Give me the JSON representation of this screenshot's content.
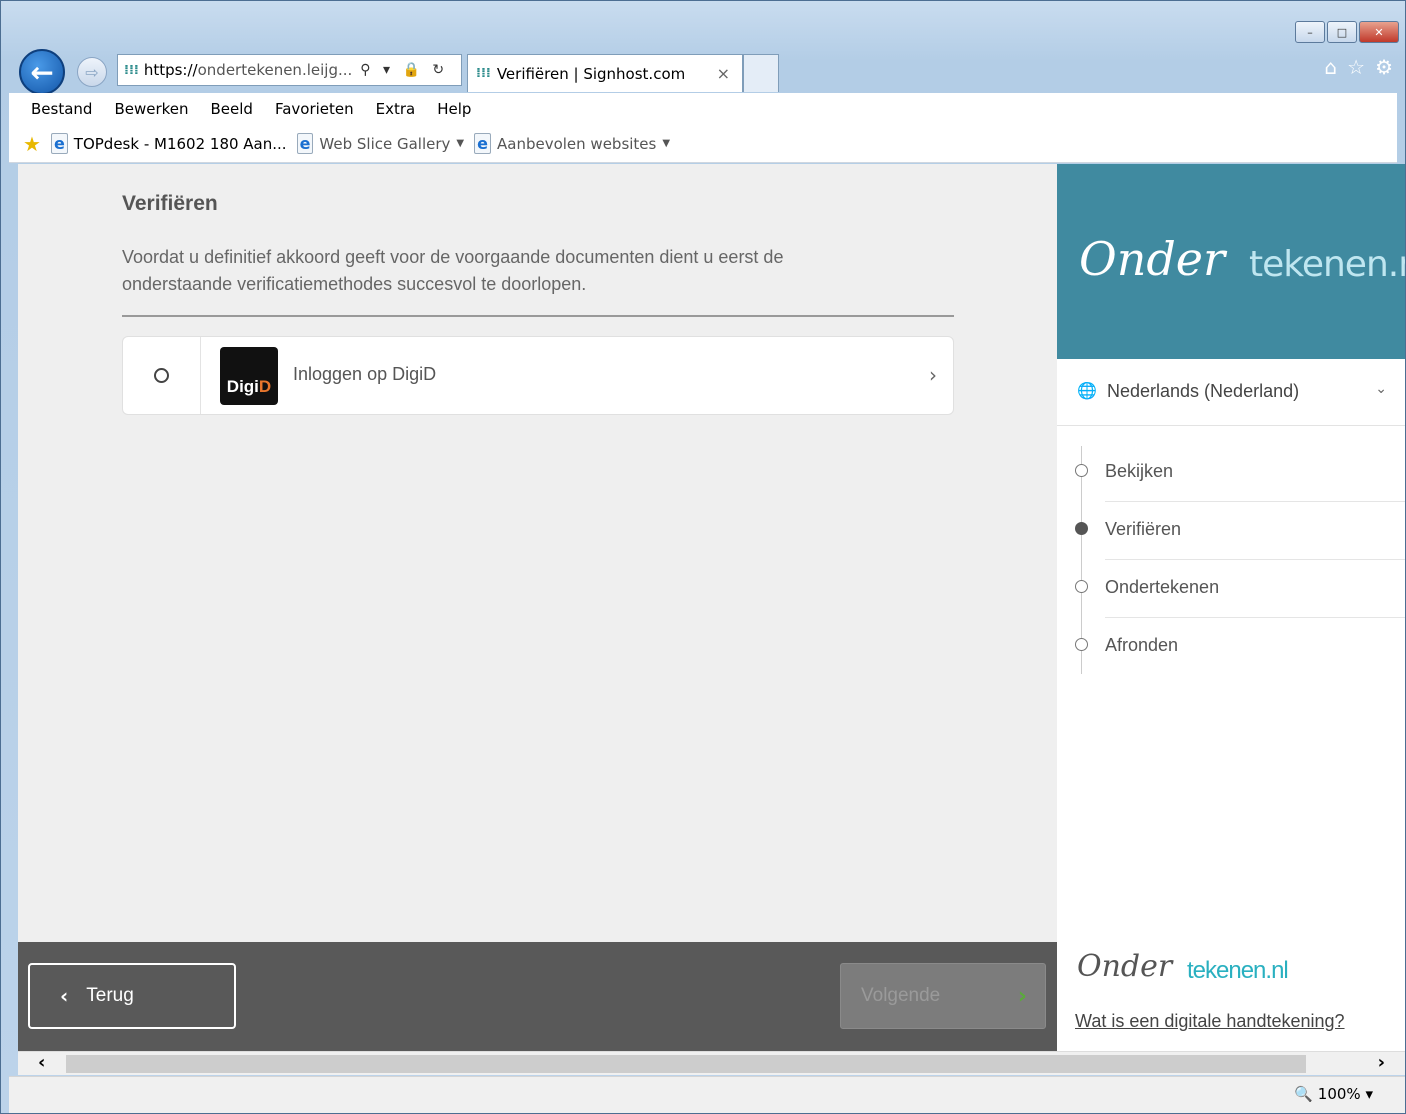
{
  "browser": {
    "url_prefix": "https://",
    "url_host": "ondertekenen.leijg...",
    "url_tools": "⚲ ▾ 🔒 ↻",
    "tab_title": "Verifiëren | Signhost.com",
    "tab_close": "×",
    "back": "←",
    "forward": "⇨",
    "window_buttons": [
      "–",
      "□",
      "✕"
    ],
    "chrome_icons": [
      "⌂",
      "☆",
      "⚙"
    ],
    "menu": [
      "Bestand",
      "Bewerken",
      "Beeld",
      "Favorieten",
      "Extra",
      "Help"
    ],
    "favorites": [
      {
        "label": "TOPdesk - M1602 180 Aan...",
        "dropdown": false
      },
      {
        "label": "Web Slice Gallery",
        "dropdown": true
      },
      {
        "label": "Aanbevolen websites",
        "dropdown": true
      }
    ],
    "zoom": "100%"
  },
  "page": {
    "title": "Verifiëren",
    "intro": "Voordat u definitief akkoord geeft voor de voorgaande documenten dient u eerst de onderstaande verificatiemethodes succesvol te doorlopen.",
    "methods": [
      {
        "logo_main": "Digi",
        "logo_accent": "D",
        "label": "Inloggen op DigiD"
      }
    ],
    "back_label": "Terug",
    "next_label": "Volgende"
  },
  "sidebar": {
    "brand_script": "Onder",
    "brand_rest": "tekenen.nl",
    "language": "Nederlands (Nederland)",
    "steps": [
      {
        "label": "Bekijken",
        "active": false
      },
      {
        "label": "Verifiëren",
        "active": true
      },
      {
        "label": "Ondertekenen",
        "active": false
      },
      {
        "label": "Afronden",
        "active": false
      }
    ],
    "footer_script": "Onder",
    "footer_rest": "tekenen.nl",
    "footer_link": "Wat is een digitale handtekening?"
  },
  "colors": {
    "brand": "#408aa0",
    "footer_bar": "#595959",
    "next_arrow": "#5aaa3a"
  }
}
